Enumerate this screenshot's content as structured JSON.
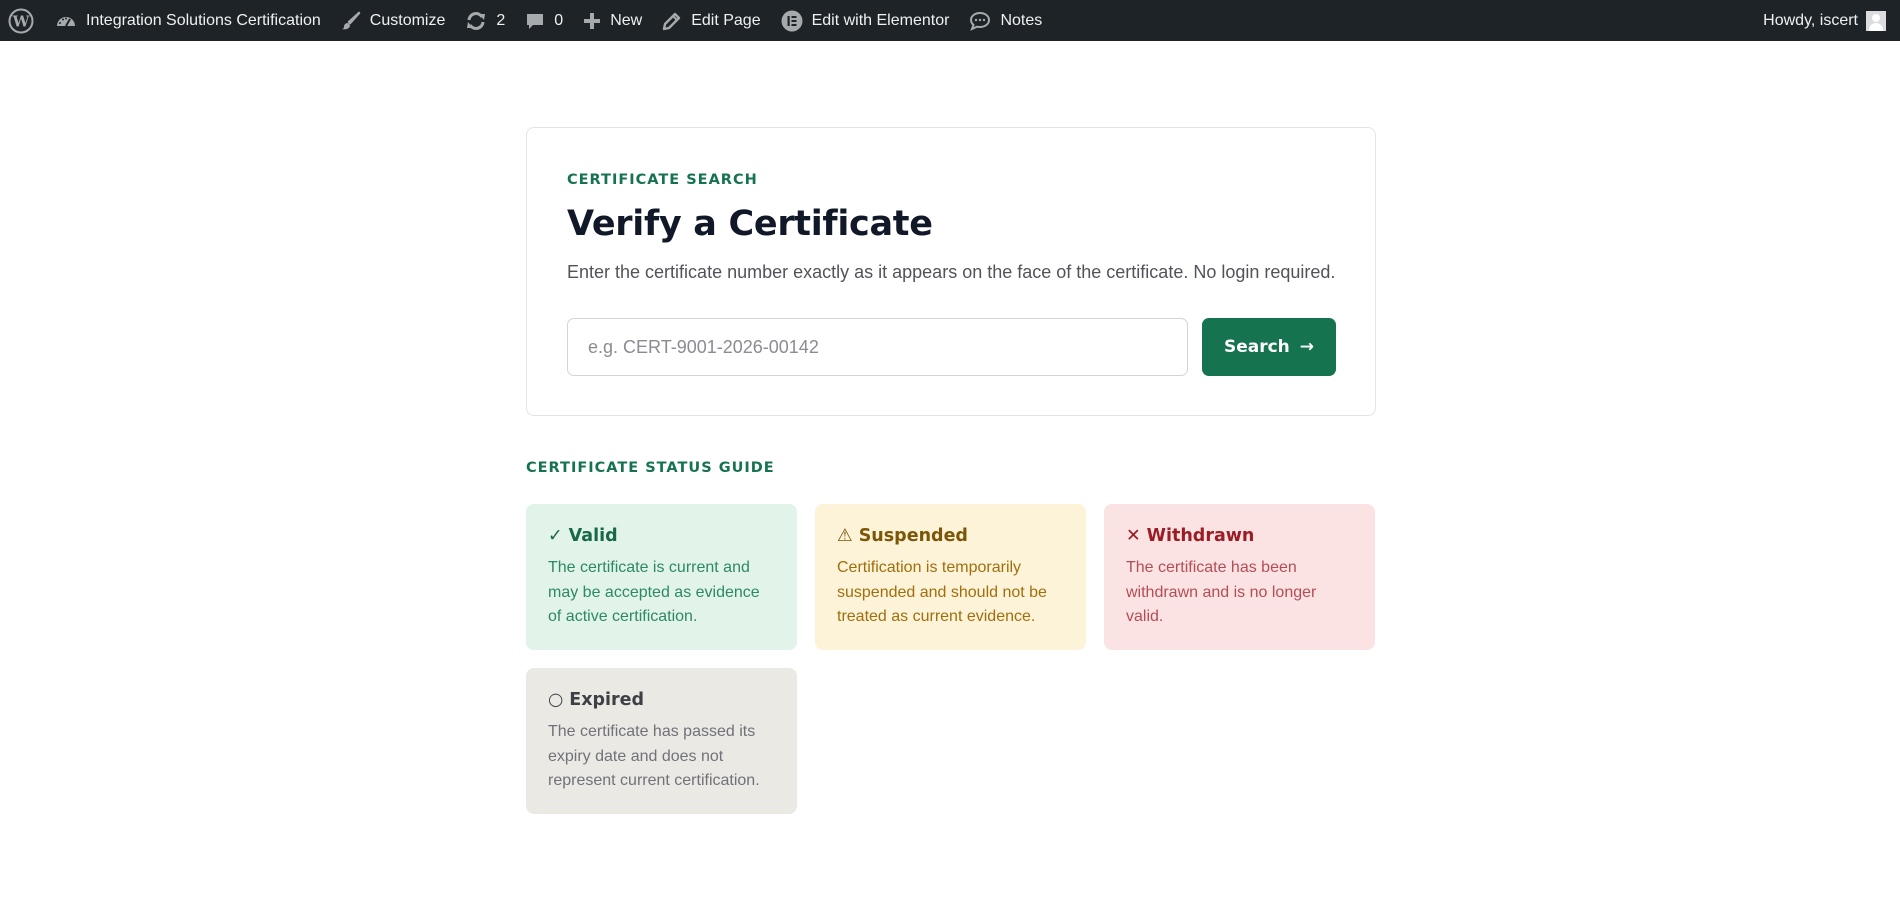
{
  "adminbar": {
    "site_name": "Integration Solutions Certification",
    "customize": "Customize",
    "updates_count": "2",
    "comments_count": "0",
    "new": "New",
    "edit_page": "Edit Page",
    "edit_elementor": "Edit with Elementor",
    "notes": "Notes",
    "howdy": "Howdy, iscert"
  },
  "search": {
    "eyebrow": "CERTIFICATE SEARCH",
    "title": "Verify a Certificate",
    "description": "Enter the certificate number exactly as it appears on the face of the certificate. No login required.",
    "placeholder": "e.g. CERT-9001-2026-00142",
    "button_label": "Search",
    "button_arrow": "→"
  },
  "guide": {
    "title": "CERTIFICATE STATUS GUIDE",
    "statuses": [
      {
        "symbol": "✓",
        "label": "Valid",
        "description": "The certificate is current and may be accepted as evidence of active certification.",
        "color": "#166a48",
        "background": "#e2f3ea"
      },
      {
        "symbol": "⚠",
        "label": "Suspended",
        "description": "Certification is temporarily suspended and should not be treated as current evidence.",
        "color": "#7b5607",
        "background": "#fdf3d9"
      },
      {
        "symbol": "✕",
        "label": "Withdrawn",
        "description": "The certificate has been withdrawn and is no longer valid.",
        "color": "#9b1c24",
        "background": "#fbe3e3"
      },
      {
        "symbol": "○",
        "label": "Expired",
        "description": "The certificate has passed its expiry date and does not represent current certification.",
        "color": "#3f3f46",
        "background": "#ebe9e4"
      }
    ]
  },
  "colors": {
    "accent": "#15734f",
    "adminbar": "#1d2327"
  }
}
